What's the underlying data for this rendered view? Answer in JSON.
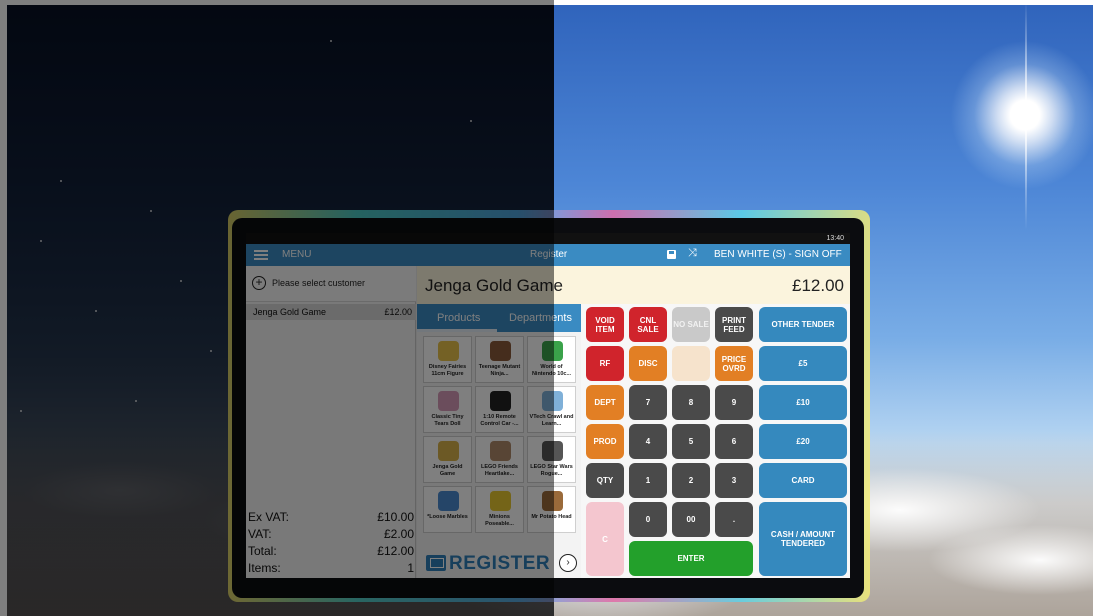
{
  "status_bar": {
    "time": "13:40"
  },
  "top_bar": {
    "menu_label": "MENU",
    "title": "Register",
    "user_label": "BEN WHITE (S) - SIGN OFF"
  },
  "customer": {
    "prompt": "Please select customer"
  },
  "basket": {
    "lines": [
      {
        "name": "Jenga Gold Game",
        "price": "£12.00"
      }
    ],
    "totals": [
      {
        "label": "Ex VAT:",
        "value": "£10.00"
      },
      {
        "label": "VAT:",
        "value": "£2.00"
      },
      {
        "label": "Total:",
        "value": "£12.00"
      },
      {
        "label": "Items:",
        "value": "1"
      }
    ]
  },
  "selected_item": {
    "name": "Jenga Gold Game",
    "price": "£12.00"
  },
  "tabs": {
    "products": "Products",
    "departments": "Departments"
  },
  "products": [
    {
      "label": "Disney Fairies 11cm Figure",
      "color": "#e8c24a"
    },
    {
      "label": "Teenage Mutant Ninja...",
      "color": "#8a5a3a"
    },
    {
      "label": "World of Nintendo 10c...",
      "color": "#3aa24a"
    },
    {
      "label": "Classic Tiny Tears Doll",
      "color": "#d79ab8"
    },
    {
      "label": "1:10 Remote Control Car -...",
      "color": "#222222"
    },
    {
      "label": "VTech Crawl and Learn...",
      "color": "#7fb0d8"
    },
    {
      "label": "Jenga Gold Game",
      "color": "#d9b24a"
    },
    {
      "label": "LEGO Friends Heartlake...",
      "color": "#b08a6a"
    },
    {
      "label": "LEGO Star Wars Rogue...",
      "color": "#555555"
    },
    {
      "label": "*Loose Marbles",
      "color": "#4a8ad0"
    },
    {
      "label": "Minions Poseable...",
      "color": "#e8c830"
    },
    {
      "label": "Mr Potato Head",
      "color": "#9a6a3a"
    }
  ],
  "logo": {
    "text": "REGISTER",
    "next_icon": "›"
  },
  "keypad": {
    "void_item": "VOID ITEM",
    "cnl_sale": "CNL SALE",
    "no_sale": "NO SALE",
    "print_feed": "PRINT FEED",
    "other_tender": "OTHER TENDER",
    "rf": "RF",
    "disc": "DISC",
    "price_ovrd": "PRICE OVRD",
    "five": "£5",
    "dept": "DEPT",
    "seven": "7",
    "eight": "8",
    "nine": "9",
    "ten": "£10",
    "prod": "PROD",
    "four": "4",
    "five_digit": "5",
    "six": "6",
    "twenty": "£20",
    "qty": "QTY",
    "one": "1",
    "two": "2",
    "three": "3",
    "card": "CARD",
    "c": "C",
    "zero": "0",
    "double_zero": "00",
    "dot": ".",
    "cash": "CASH / AMOUNT TENDERED",
    "enter": "ENTER"
  },
  "colors": {
    "accent_blue": "#3a8bc2",
    "key_red": "#d0242c",
    "key_orange": "#e27f24",
    "key_dark": "#4a4a4a",
    "key_green": "#23a02b"
  }
}
